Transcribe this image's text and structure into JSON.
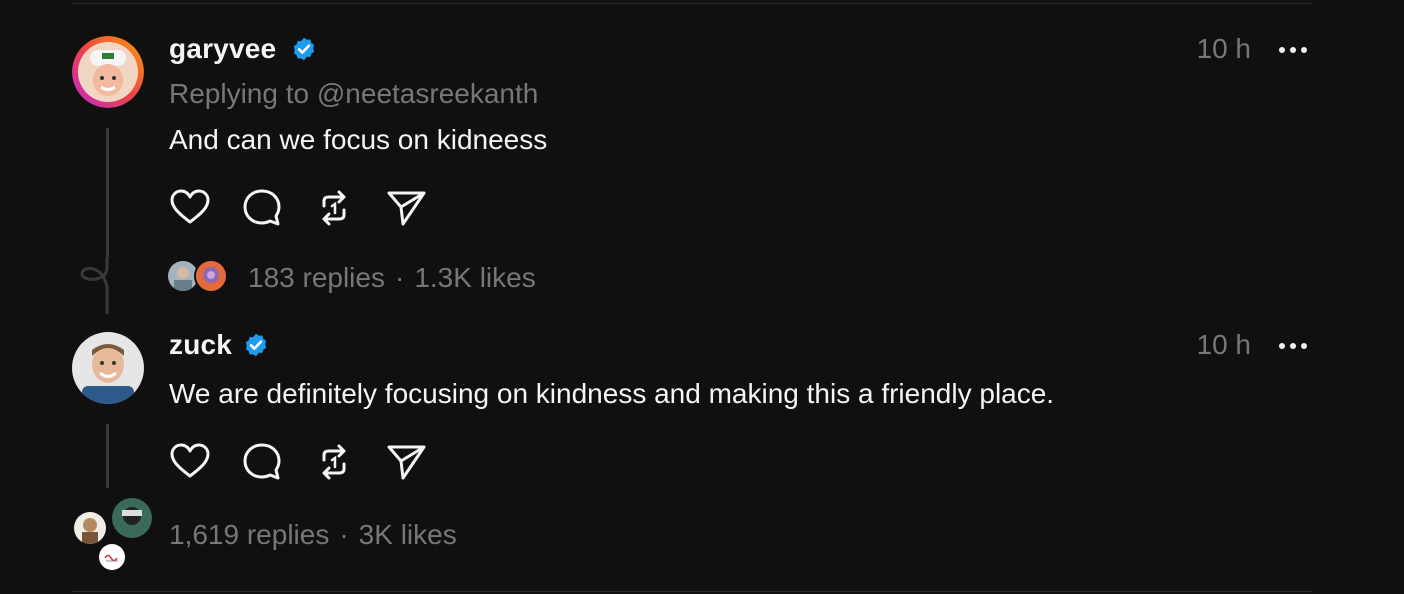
{
  "posts": [
    {
      "username": "garyvee",
      "verified": true,
      "time": "10 h",
      "replying_prefix": "Replying to",
      "replying_handle": "@neetasreekanth",
      "text": "And can we focus on kidneess",
      "replies": "183 replies",
      "separator": "·",
      "likes": "1.3K likes"
    },
    {
      "username": "zuck",
      "verified": true,
      "time": "10 h",
      "text": "We are definitely focusing on kindness and making this a friendly place.",
      "replies": "1,619 replies",
      "separator": "·",
      "likes": "3K likes"
    }
  ],
  "icons": {
    "verified": "verified-badge-icon",
    "more": "more-options-icon",
    "like": "heart-icon",
    "comment": "comment-bubble-icon",
    "repost": "repost-icon",
    "share": "send-icon",
    "thread_loop": "thread-loop-icon"
  },
  "colors": {
    "background": "#101010",
    "text": "#f3f5f7",
    "muted": "#777777",
    "verified": "#1d9bf0"
  }
}
